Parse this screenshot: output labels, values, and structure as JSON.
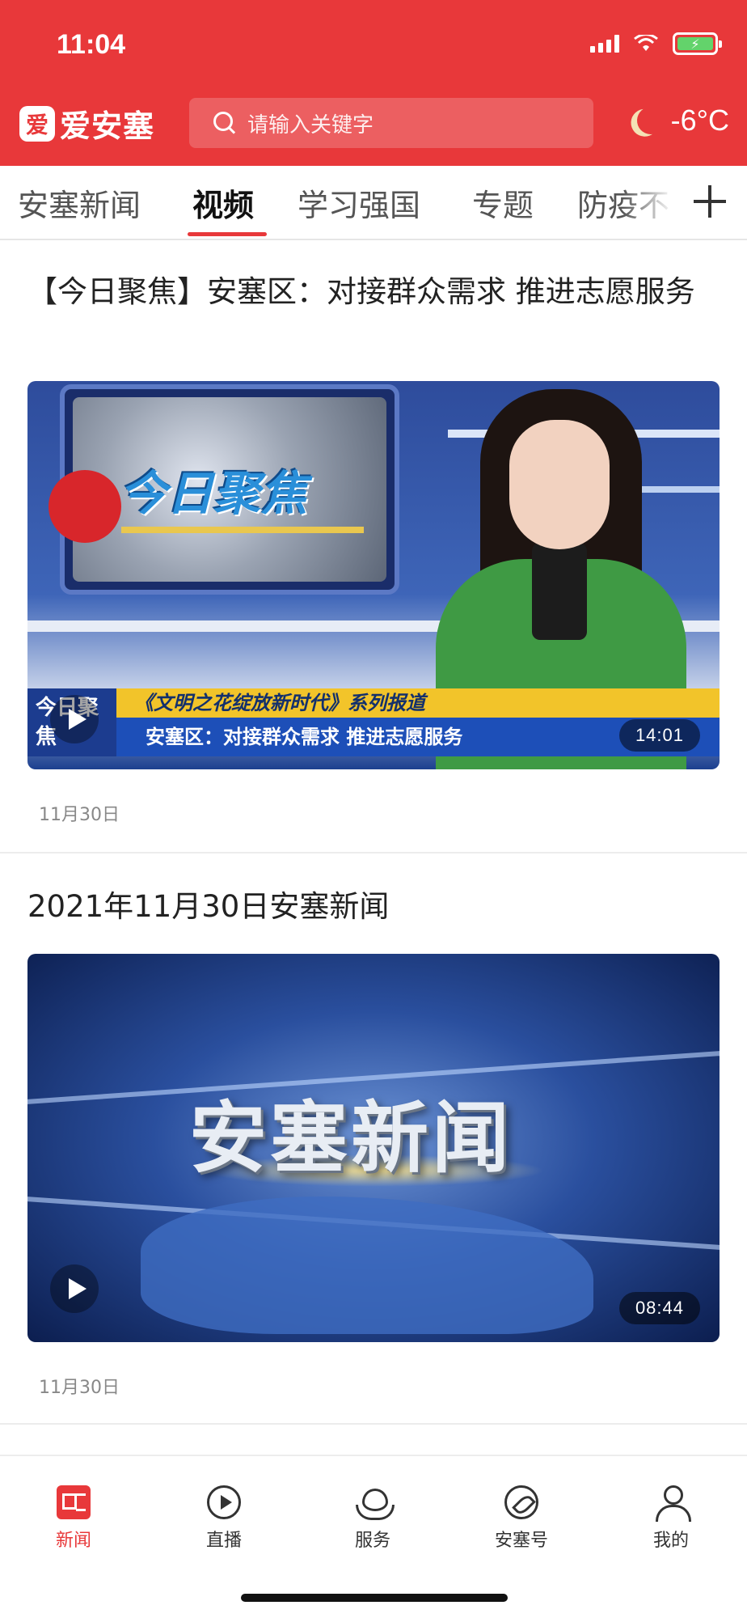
{
  "status_bar": {
    "time": "11:04"
  },
  "header": {
    "logo_text": "爱安塞",
    "logo_mark": "爱",
    "search_placeholder": "请输入关键字",
    "temperature": "-6°C",
    "weather_icon": "moon-icon",
    "accent_color": "#e8383a"
  },
  "tabs": [
    {
      "label": "安塞新闻",
      "active": false
    },
    {
      "label": "视频",
      "active": true
    },
    {
      "label": "学习强国",
      "active": false
    },
    {
      "label": "专题",
      "active": false
    },
    {
      "label": "防疫不",
      "active": false
    }
  ],
  "feed": [
    {
      "title": "【今日聚焦】安塞区：对接群众需求 推进志愿服务",
      "duration": "14:01",
      "date": "11月30日",
      "thumb": {
        "screen_logo": "今日聚焦",
        "tag": "今日聚焦",
        "caption_top": "《文明之花绽放新时代》系列报道",
        "caption_bottom": "安塞区：对接群众需求  推进志愿服务"
      }
    },
    {
      "title": "2021年11月30日安塞新闻",
      "duration": "08:44",
      "date": "11月30日",
      "thumb": {
        "scene_title": "安塞新闻"
      }
    }
  ],
  "bottom_nav": [
    {
      "label": "新闻",
      "icon": "news-icon",
      "active": true
    },
    {
      "label": "直播",
      "icon": "live-play-icon",
      "active": false
    },
    {
      "label": "服务",
      "icon": "service-heart-icon",
      "active": false
    },
    {
      "label": "安塞号",
      "icon": "compass-icon",
      "active": false
    },
    {
      "label": "我的",
      "icon": "user-icon",
      "active": false
    }
  ]
}
